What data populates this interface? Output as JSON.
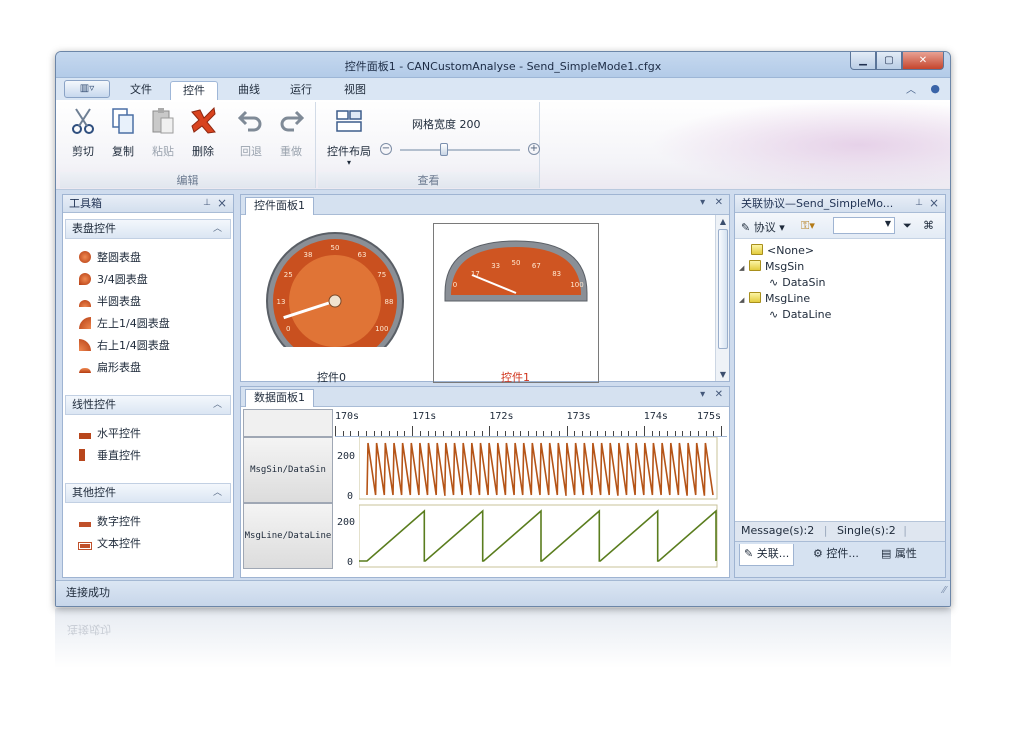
{
  "window": {
    "title": "控件面板1 - CANCustomAnalyse - Send_SimpleMode1.cfgx"
  },
  "ribbon_tabs": [
    {
      "label": "文件"
    },
    {
      "label": "控件",
      "active": true
    },
    {
      "label": "曲线"
    },
    {
      "label": "运行"
    },
    {
      "label": "视图"
    }
  ],
  "ribbon": {
    "edit_group": {
      "label": "编辑",
      "buttons": [
        {
          "label": "剪切",
          "icon": "scissors-icon",
          "enabled": true
        },
        {
          "label": "复制",
          "icon": "copy-icon",
          "enabled": true
        },
        {
          "label": "粘贴",
          "icon": "paste-icon",
          "enabled": false
        },
        {
          "label": "删除",
          "icon": "delete-icon",
          "enabled": true
        },
        {
          "label": "回退",
          "icon": "undo-icon",
          "enabled": false
        },
        {
          "label": "重做",
          "icon": "redo-icon",
          "enabled": false
        }
      ]
    },
    "view_group": {
      "label": "查看",
      "layout_button": "控件布局",
      "grid_width_label": "网格宽度 200",
      "grid_width_value": 200
    }
  },
  "toolbox": {
    "title": "工具箱",
    "groups": [
      {
        "label": "表盘控件",
        "items": [
          "整圆表盘",
          "3/4圆表盘",
          "半圆表盘",
          "左上1/4圆表盘",
          "右上1/4圆表盘",
          "扁形表盘"
        ]
      },
      {
        "label": "线性控件",
        "items": [
          "水平控件",
          "垂直控件"
        ]
      },
      {
        "label": "其他控件",
        "items": [
          "数字控件",
          "文本控件"
        ]
      }
    ]
  },
  "control_panel": {
    "tab": "控件面板1",
    "gauges": [
      {
        "caption": "控件0",
        "caption_color": "#1e2a3a",
        "ticks": [
          "0",
          "13",
          "25",
          "38",
          "50",
          "63",
          "75",
          "88",
          "100"
        ],
        "value": 5
      },
      {
        "caption": "控件1",
        "caption_color": "#d0341c",
        "ticks": [
          "0",
          "17",
          "33",
          "50",
          "67",
          "83",
          "100"
        ],
        "value": 14
      }
    ]
  },
  "data_panel": {
    "tab": "数据面板1",
    "time_ticks": [
      "170s",
      "171s",
      "172s",
      "173s",
      "174s",
      "175s"
    ],
    "rows": [
      {
        "label": "MsgSin/DataSin",
        "ymax": "200",
        "ymin": "0",
        "color": "#b55417"
      },
      {
        "label": "MsgLine/DataLine",
        "ymax": "200",
        "ymin": "0",
        "color": "#5a7d1e"
      }
    ]
  },
  "right_panel": {
    "title": "关联协议—Send_SimpleMo...",
    "toolbar_protocol": "协议",
    "tree": [
      {
        "label": "<None>",
        "level": 0,
        "type": "message"
      },
      {
        "label": "MsgSin",
        "level": 0,
        "type": "message",
        "expanded": true
      },
      {
        "label": "DataSin",
        "level": 1,
        "type": "signal"
      },
      {
        "label": "MsgLine",
        "level": 0,
        "type": "message",
        "expanded": true
      },
      {
        "label": "DataLine",
        "level": 1,
        "type": "signal"
      }
    ],
    "status_messages": "Message(s):2",
    "status_singles": "Single(s):2",
    "tabs": [
      {
        "label": "关联...",
        "active": true
      },
      {
        "label": "控件...",
        "active": false
      },
      {
        "label": "属性",
        "active": false
      }
    ]
  },
  "statusbar": {
    "text": "连接成功"
  },
  "colors": {
    "accent": "#b55417",
    "frame": "#6c86a8",
    "ribbon_bg": "#dae6f4"
  }
}
